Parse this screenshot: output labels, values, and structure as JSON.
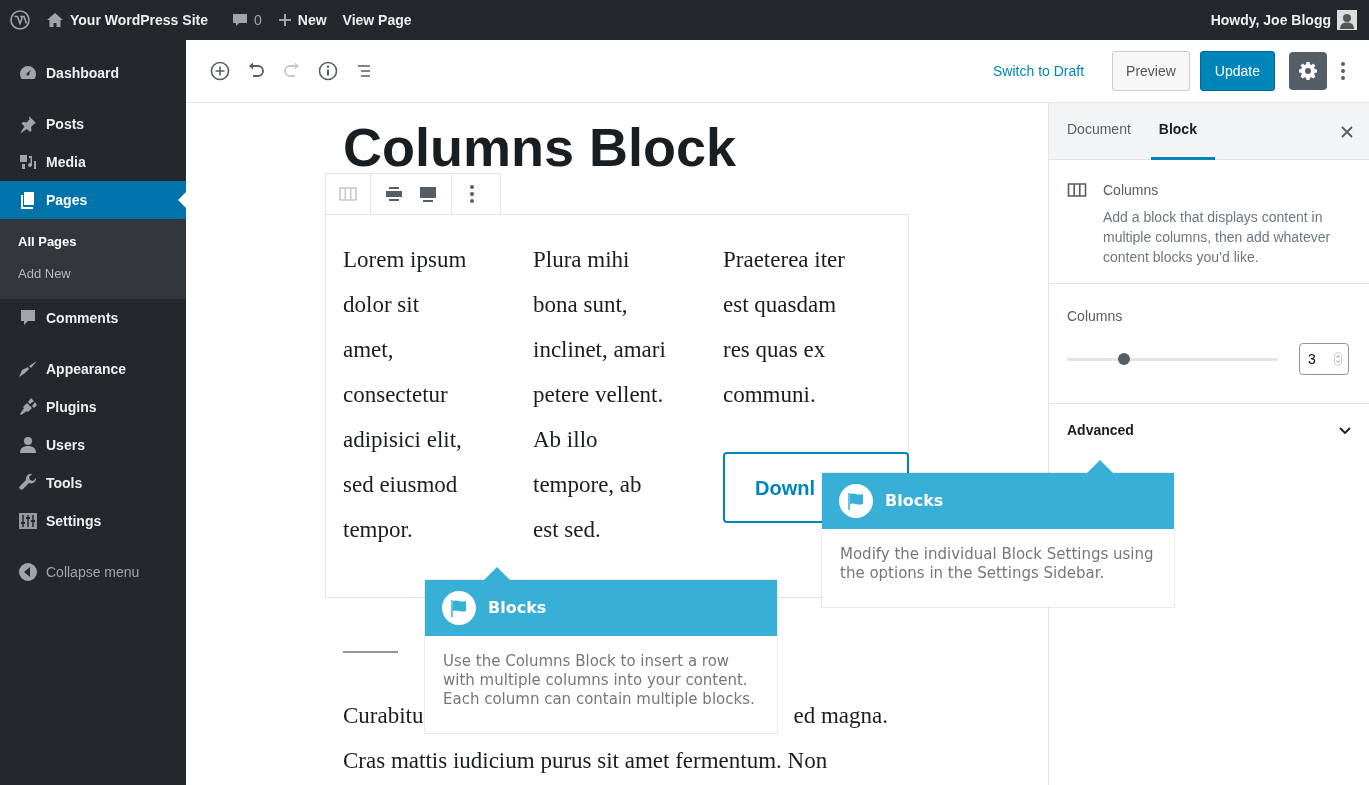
{
  "admin_bar": {
    "site_name": "Your WordPress Site",
    "comments_count": "0",
    "new_label": "New",
    "view_label": "View Page",
    "greeting": "Howdy, Joe Blogg"
  },
  "admin_menu": {
    "groups": [
      {
        "items": [
          {
            "label": "Dashboard",
            "selected": false
          }
        ]
      },
      {
        "items": [
          {
            "label": "Posts",
            "selected": false
          },
          {
            "label": "Media",
            "selected": false
          },
          {
            "label": "Pages",
            "selected": true,
            "children": [
              {
                "label": "All Pages",
                "selected": true
              },
              {
                "label": "Add New",
                "selected": false
              }
            ]
          },
          {
            "label": "Comments",
            "selected": false
          }
        ]
      },
      {
        "items": [
          {
            "label": "Appearance",
            "selected": false
          },
          {
            "label": "Plugins",
            "selected": false
          },
          {
            "label": "Users",
            "selected": false
          },
          {
            "label": "Tools",
            "selected": false
          },
          {
            "label": "Settings",
            "selected": false
          }
        ]
      }
    ],
    "collapse_label": "Collapse menu"
  },
  "editor_toolbar": {
    "tools": [
      {
        "disabled": false
      },
      {
        "disabled": false
      },
      {
        "disabled": true
      },
      {
        "disabled": false
      },
      {
        "disabled": false
      }
    ],
    "switch_to_draft": "Switch to Draft",
    "preview": "Preview",
    "update": "Update",
    "settings_toggle": {
      "pressed": true
    }
  },
  "editor": {
    "title": "Columns Block",
    "columns": [
      {
        "lines": [
          "Lorem ipsum",
          "dolor sit",
          "amet,",
          "consectetur",
          "adipisici elit,",
          "sed eiusmod",
          "tempor."
        ]
      },
      {
        "lines": [
          "Plura mihi",
          "bona sunt,",
          "inclinet, amari",
          "petere vellent.",
          "Ab illo",
          "tempore, ab",
          "est sed."
        ]
      },
      {
        "lines": [
          "Praeterea iter",
          "est quasdam",
          "res quas ex",
          "communi."
        ]
      }
    ],
    "button_text": "Downl",
    "paragraph": {
      "line_1_start": "Curabitu",
      "line_1_end": "ed magna.",
      "line_2": "Cras mattis iudicium purus sit amet fermentum. Non"
    }
  },
  "settings_sidebar": {
    "tabs": [
      {
        "label": "Document",
        "selected": false
      },
      {
        "label": "Block",
        "selected": true
      }
    ],
    "block_name": "Columns",
    "block_description": "Add a block that displays content in multiple columns, then add whatever content blocks you’d like.",
    "columns_label": "Columns",
    "columns_slider": {
      "level": 0.27
    },
    "columns_value": "3",
    "advanced": {
      "label": "Advanced",
      "expanded": false
    }
  },
  "tooltips": [
    {
      "title": "Blocks",
      "body": "Use the Columns Block to insert a row with multiple columns into your content. Each column can contain multiple blocks."
    },
    {
      "title": "Blocks",
      "body": "Modify the individual Block Settings using the options in the Settings Sidebar."
    }
  ]
}
